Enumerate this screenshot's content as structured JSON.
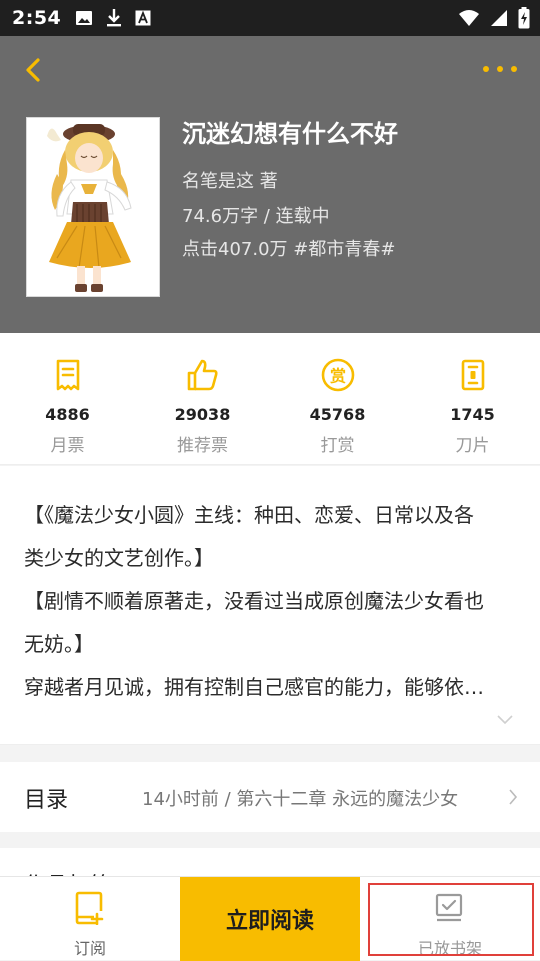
{
  "status_bar": {
    "time": "2:54",
    "left_icons": [
      "image-icon",
      "download-icon",
      "font-icon"
    ],
    "right_icons": [
      "wifi-icon",
      "signal-icon",
      "battery-charging-icon"
    ]
  },
  "header": {
    "background": "#6b6b6b",
    "accent": "#f8bc00",
    "book": {
      "title": "沉迷幻想有什么不好",
      "author_line": "名笔是这  著",
      "words_status": "74.6万字 / 连载中",
      "clicks_tag": "点击407.0万  #都市青春#"
    }
  },
  "stats": [
    {
      "icon": "monthly-ticket-icon",
      "value": "4886",
      "label": "月票"
    },
    {
      "icon": "thumbs-up-icon",
      "value": "29038",
      "label": "推荐票"
    },
    {
      "icon": "reward-coin-icon",
      "value": "45768",
      "label": "打赏"
    },
    {
      "icon": "blade-icon",
      "value": "1745",
      "label": "刀片"
    }
  ],
  "intro": {
    "lines": [
      "【《魔法少女小圆》主线：种田、恋爱、日常以及各",
      "类少女的文艺创作。】",
      "【剧情不顺着原著走，没看过当成原创魔法少女看也",
      "无妨。】",
      "穿越者月见诚，拥有控制自己感官的能力，能够依…"
    ]
  },
  "catalog": {
    "title": "目录",
    "latest": "14小时前 / 第六十二章 永远的魔法少女"
  },
  "next_section": {
    "title": "作品标签"
  },
  "bottom_bar": {
    "subscribe_label": "订阅",
    "read_label": "立即阅读",
    "shelf_label": "已放书架"
  }
}
